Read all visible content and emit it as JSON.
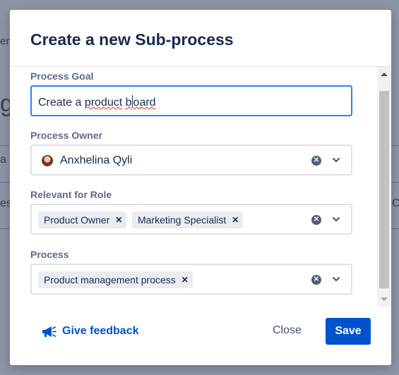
{
  "background": {
    "fragments": [
      "ent",
      "g",
      "a",
      "es",
      "C"
    ]
  },
  "dialog": {
    "title": "Create a new Sub-process",
    "process_goal": {
      "label": "Process Goal",
      "value_prefix": "Create a ",
      "value_misspelled_1": "product",
      "value_mid": " ",
      "value_misspelled_2a": "b",
      "value_misspelled_2b": "oard"
    },
    "process_owner": {
      "label": "Process Owner",
      "value": "Anxhelina Qyli"
    },
    "relevant_for_role": {
      "label": "Relevant for Role",
      "chips": [
        "Product Owner",
        "Marketing Specialist"
      ]
    },
    "process": {
      "label": "Process",
      "chips": [
        "Product management process"
      ]
    },
    "footer": {
      "feedback_label": "Give feedback",
      "close_label": "Close",
      "save_label": "Save"
    }
  },
  "icons": {
    "clear": "clear-icon",
    "chevron": "chevron-down-icon",
    "remove": "remove-chip-icon",
    "megaphone": "megaphone-icon"
  },
  "colors": {
    "primary": "#0052cc",
    "focus_border": "#2684ff",
    "label": "#5e6c84",
    "overlay": "#8e95a6"
  }
}
